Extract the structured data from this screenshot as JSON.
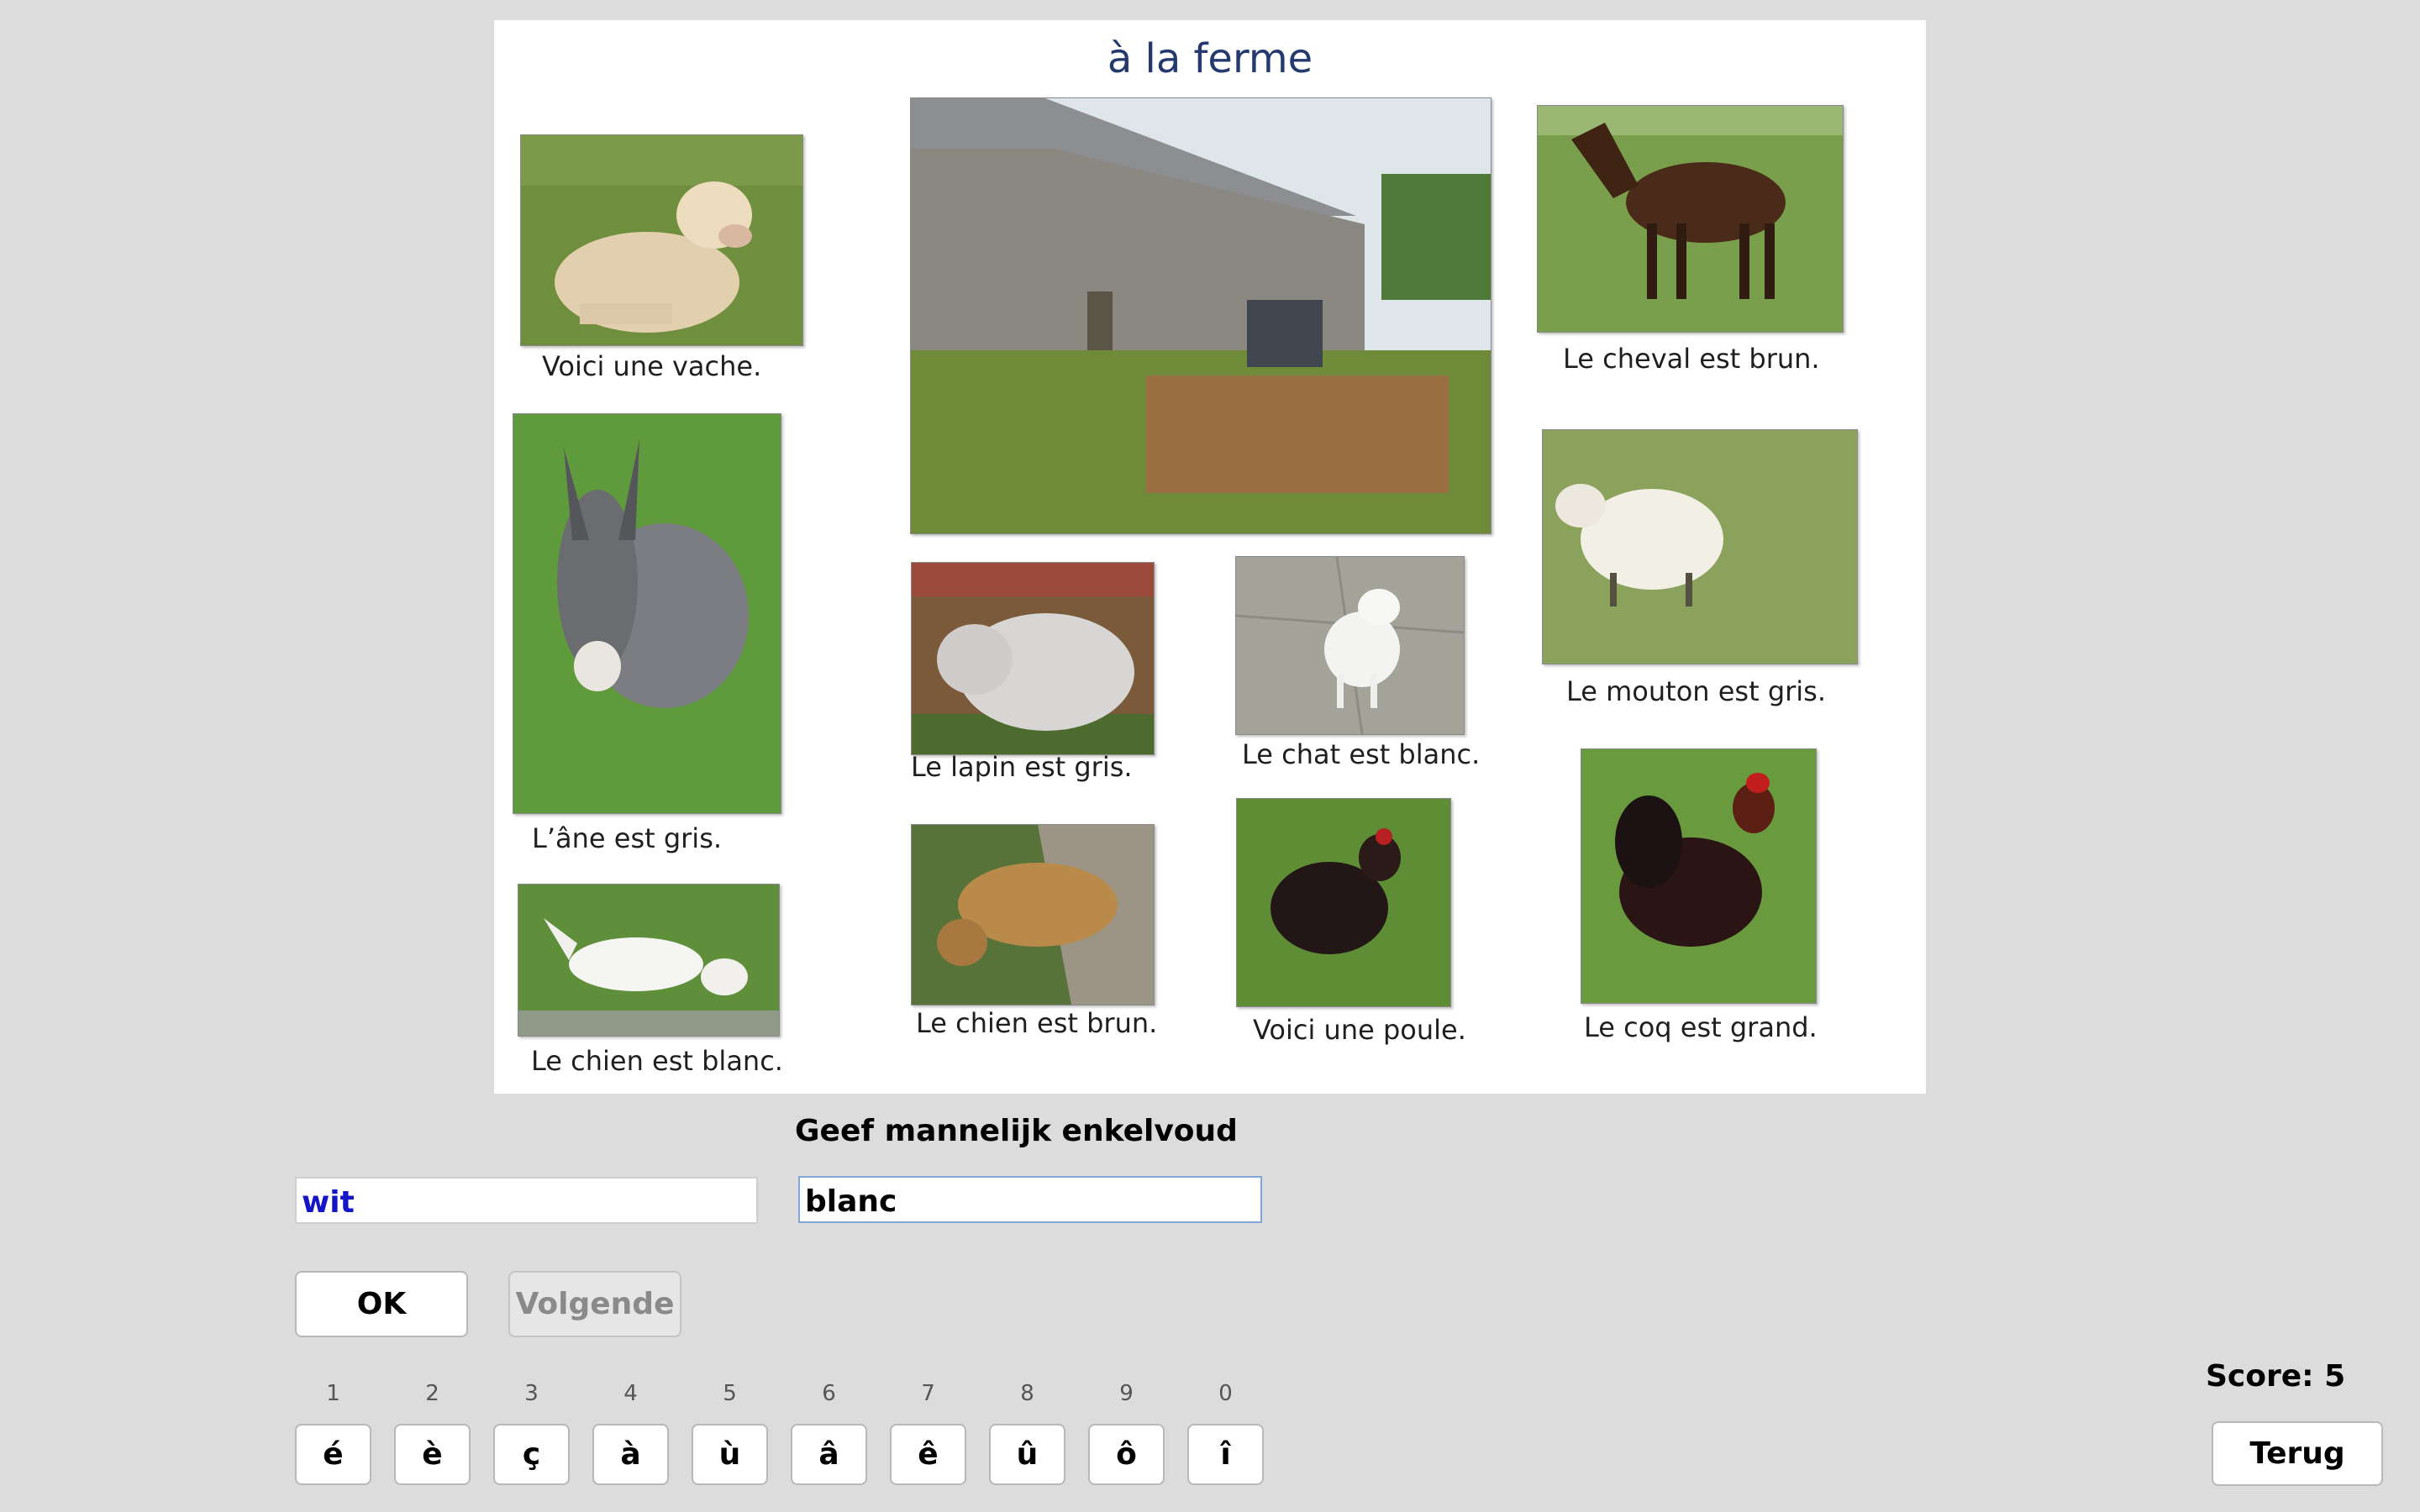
{
  "board": {
    "title": "à la ferme",
    "captions": {
      "cow": "Voici une vache.",
      "horse": "Le cheval est brun.",
      "donkey": "L’âne est gris.",
      "rabbit": "Le lapin est gris.",
      "cat": "Le chat est blanc.",
      "sheep": "Le mouton est gris.",
      "white_dog": "Le chien est blanc.",
      "brown_dog": "Le chien est brun.",
      "hen": "Voici une poule.",
      "rooster": "Le coq est grand."
    }
  },
  "exercise": {
    "prompt": "Geef mannelijk enkelvoud",
    "source_word": "wit",
    "answer_value": "blanc",
    "ok_label": "OK",
    "next_label": "Volgende",
    "score_label": "Score: 5",
    "back_label": "Terug"
  },
  "special_chars": [
    {
      "key": "1",
      "char": "é"
    },
    {
      "key": "2",
      "char": "è"
    },
    {
      "key": "3",
      "char": "ç"
    },
    {
      "key": "4",
      "char": "à"
    },
    {
      "key": "5",
      "char": "ù"
    },
    {
      "key": "6",
      "char": "â"
    },
    {
      "key": "7",
      "char": "ê"
    },
    {
      "key": "8",
      "char": "û"
    },
    {
      "key": "9",
      "char": "ô"
    },
    {
      "key": "0",
      "char": "î"
    }
  ]
}
